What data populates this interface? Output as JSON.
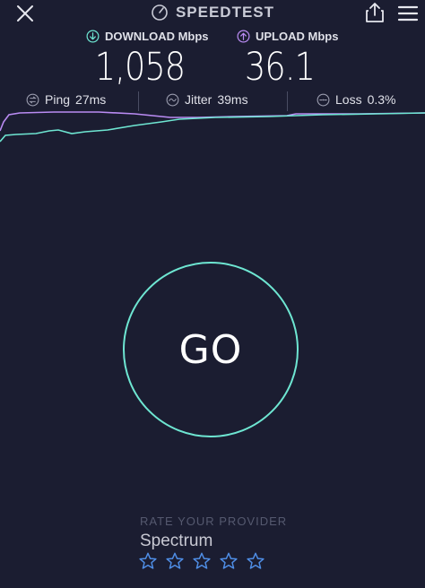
{
  "header": {
    "brand": "SPEEDTEST",
    "icons": {
      "close": "close-icon",
      "logo": "speedometer-icon",
      "share": "share-icon",
      "menu": "menu-icon"
    }
  },
  "metrics": {
    "download": {
      "label": "DOWNLOAD Mbps",
      "value": "1,058",
      "icon": "download-arrow-icon",
      "color": "#6ee6d2"
    },
    "upload": {
      "label": "UPLOAD Mbps",
      "value": "36.1",
      "icon": "upload-arrow-icon",
      "color": "#b98bf2"
    }
  },
  "stats": {
    "ping": {
      "label": "Ping",
      "value": "27ms",
      "icon": "ping-icon"
    },
    "jitter": {
      "label": "Jitter",
      "value": "39ms",
      "icon": "jitter-icon"
    },
    "loss": {
      "label": "Loss",
      "value": "0.3%",
      "icon": "loss-icon"
    }
  },
  "go_button": {
    "label": "GO",
    "color": "#6ee6d2"
  },
  "rating": {
    "label": "RATE YOUR PROVIDER",
    "provider": "Spectrum",
    "stars_total": 5,
    "stars_filled": 0,
    "star_color": "#4f8ee6"
  },
  "colors": {
    "background": "#1b1d31",
    "download_line": "#6ee6d2",
    "upload_line": "#b98bf2"
  }
}
